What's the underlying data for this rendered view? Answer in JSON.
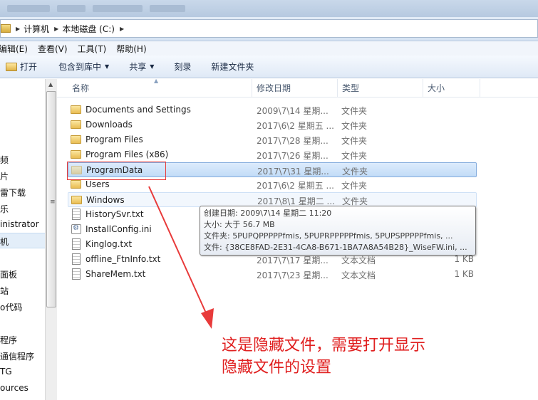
{
  "address": {
    "crumbs": [
      "计算机",
      "本地磁盘 (C:)"
    ]
  },
  "menu": {
    "items": [
      "编辑(E)",
      "查看(V)",
      "工具(T)",
      "帮助(H)"
    ]
  },
  "toolbar": {
    "open": "打开",
    "include_library": "包含到库中",
    "share": "共享",
    "burn": "刻录",
    "new_folder": "新建文件夹"
  },
  "nav": {
    "items": [
      "频",
      "片",
      "雷下载",
      "乐",
      "inistrator",
      "机",
      "面板",
      "站",
      "o代码",
      "程序",
      "通信程序",
      "TG",
      "ources"
    ],
    "selected": "机"
  },
  "columns": {
    "name": "名称",
    "date": "修改日期",
    "type": "类型",
    "size": "大小"
  },
  "files": [
    {
      "name": "Documents and Settings",
      "date": "2009\\7\\14 星期...",
      "type": "文件夹",
      "size": "",
      "icon": "folder"
    },
    {
      "name": "Downloads",
      "date": "2017\\6\\2 星期五 ...",
      "type": "文件夹",
      "size": "",
      "icon": "folder"
    },
    {
      "name": "Program Files",
      "date": "2017\\7\\28 星期...",
      "type": "文件夹",
      "size": "",
      "icon": "folder"
    },
    {
      "name": "Program Files (x86)",
      "date": "2017\\7\\26 星期...",
      "type": "文件夹",
      "size": "",
      "icon": "folder"
    },
    {
      "name": "ProgramData",
      "date": "2017\\7\\31 星期...",
      "type": "文件夹",
      "size": "",
      "icon": "folder-hidden",
      "selected": true
    },
    {
      "name": "Users",
      "date": "2017\\6\\2 星期五 ...",
      "type": "文件夹",
      "size": "",
      "icon": "folder"
    },
    {
      "name": "Windows",
      "date": "2017\\8\\1 星期二 ...",
      "type": "文件夹",
      "size": "",
      "icon": "folder",
      "hover": true
    },
    {
      "name": "HistorySvr.txt",
      "date": "",
      "type": "",
      "size": "",
      "icon": "doc"
    },
    {
      "name": "InstallConfig.ini",
      "date": "",
      "type": "",
      "size": "",
      "icon": "cfg"
    },
    {
      "name": "Kinglog.txt",
      "date": "",
      "type": "",
      "size": "",
      "icon": "doc"
    },
    {
      "name": "offline_FtnInfo.txt",
      "date": "2017\\7\\17 星期...",
      "type": "文本文档",
      "size": "1 KB",
      "icon": "doc"
    },
    {
      "name": "ShareMem.txt",
      "date": "2017\\7\\23 星期...",
      "type": "文本文档",
      "size": "1 KB",
      "icon": "doc"
    }
  ],
  "tooltip": {
    "lines": [
      "创建日期: 2009\\7\\14 星期二 11:20",
      "大小: 大于 56.7 MB",
      "文件夹: 5PUPQPPPPPfmis, 5PUPRPPPPPfmis, 5PUPSPPPPPfmis, ...",
      "文件: {38CE8FAD-2E31-4CA8-B671-1BA7A8A54B28}_WiseFW.ini, ..."
    ]
  },
  "annotation": {
    "lines": [
      "这是隐藏文件，需要打开显示",
      "隐藏文件的设置"
    ],
    "color": "#e02020"
  }
}
